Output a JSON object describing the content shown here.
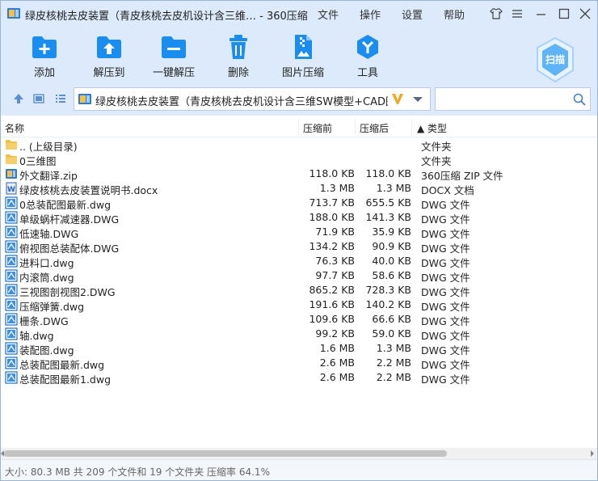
{
  "window": {
    "title": "绿皮核桃去皮装置（青皮核桃去皮机设计含三维…  - 360压缩",
    "menus": [
      "文件",
      "操作",
      "设置",
      "帮助"
    ]
  },
  "toolbar": {
    "buttons": [
      {
        "label": "添加",
        "icon": "add-archive-icon"
      },
      {
        "label": "解压到",
        "icon": "extract-to-icon"
      },
      {
        "label": "一键解压",
        "icon": "one-click-extract-icon"
      },
      {
        "label": "删除",
        "icon": "trash-icon"
      },
      {
        "label": "图片压缩",
        "icon": "image-compress-icon"
      },
      {
        "label": "工具",
        "icon": "tools-icon"
      }
    ],
    "scan_label": "扫描"
  },
  "addressbar": {
    "path": "绿皮核桃去皮装置（青皮核桃去皮机设计含三维SW模型+CAD图纸+说明书）.zip",
    "search_placeholder": ""
  },
  "columns": {
    "name": "名称",
    "size": "压缩前",
    "compressed": "压缩后",
    "type": "▲ 类型"
  },
  "files": [
    {
      "name": ".. (上级目录)",
      "size": "",
      "compressed": "",
      "type": "文件夹",
      "icon": "folder-icon"
    },
    {
      "name": "0三维图",
      "size": "",
      "compressed": "",
      "type": "文件夹",
      "icon": "folder-icon"
    },
    {
      "name": "外文翻译.zip",
      "size": "118.0 KB",
      "compressed": "118.0 KB",
      "type": "360压缩 ZIP 文件",
      "icon": "zip-icon"
    },
    {
      "name": "绿皮核桃去皮装置说明书.docx",
      "size": "1.3 MB",
      "compressed": "1.3 MB",
      "type": "DOCX 文档",
      "icon": "word-icon"
    },
    {
      "name": "0总装配图最新.dwg",
      "size": "713.7 KB",
      "compressed": "655.5 KB",
      "type": "DWG 文件",
      "icon": "dwg-icon"
    },
    {
      "name": "单级蜗杆减速器.DWG",
      "size": "188.0 KB",
      "compressed": "141.3 KB",
      "type": "DWG 文件",
      "icon": "dwg-icon"
    },
    {
      "name": "低速轴.DWG",
      "size": "71.9 KB",
      "compressed": "35.9 KB",
      "type": "DWG 文件",
      "icon": "dwg-icon"
    },
    {
      "name": "俯视图总装配体.DWG",
      "size": "134.2 KB",
      "compressed": "90.9 KB",
      "type": "DWG 文件",
      "icon": "dwg-icon"
    },
    {
      "name": "进料口.dwg",
      "size": "76.3 KB",
      "compressed": "40.0 KB",
      "type": "DWG 文件",
      "icon": "dwg-icon"
    },
    {
      "name": "内滚筒.dwg",
      "size": "97.7 KB",
      "compressed": "58.6 KB",
      "type": "DWG 文件",
      "icon": "dwg-icon"
    },
    {
      "name": "三视图剖视图2.DWG",
      "size": "865.2 KB",
      "compressed": "728.3 KB",
      "type": "DWG 文件",
      "icon": "dwg-icon"
    },
    {
      "name": "压缩弹簧.dwg",
      "size": "191.6 KB",
      "compressed": "140.2 KB",
      "type": "DWG 文件",
      "icon": "dwg-icon"
    },
    {
      "name": "栅条.DWG",
      "size": "109.6 KB",
      "compressed": "66.6 KB",
      "type": "DWG 文件",
      "icon": "dwg-icon"
    },
    {
      "name": "轴.dwg",
      "size": "99.2 KB",
      "compressed": "59.0 KB",
      "type": "DWG 文件",
      "icon": "dwg-icon"
    },
    {
      "name": "装配图.dwg",
      "size": "1.6 MB",
      "compressed": "1.3 MB",
      "type": "DWG 文件",
      "icon": "dwg-icon"
    },
    {
      "name": "总装配图最新.dwg",
      "size": "2.6 MB",
      "compressed": "2.2 MB",
      "type": "DWG 文件",
      "icon": "dwg-icon"
    },
    {
      "name": "总装配图最新1.dwg",
      "size": "2.6 MB",
      "compressed": "2.2 MB",
      "type": "DWG 文件",
      "icon": "dwg-icon"
    }
  ],
  "status": "大小: 80.3 MB 共 209 个文件和 19 个文件夹 压缩率 64.1%",
  "colors": {
    "chrome": "#dceafb",
    "accent": "#1a8ef0",
    "folder": "#f4c04a"
  }
}
